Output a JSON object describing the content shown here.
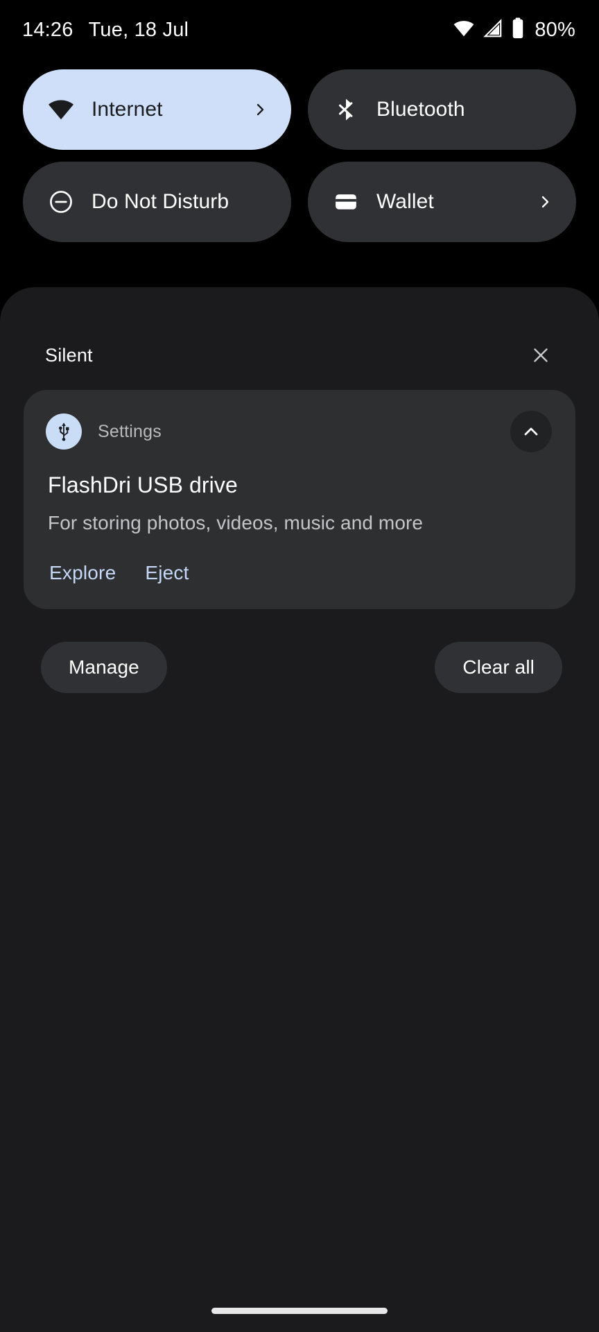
{
  "status_bar": {
    "time": "14:26",
    "date": "Tue, 18 Jul",
    "battery_percent": "80%",
    "icons": [
      "wifi-icon",
      "cellular-signal-icon",
      "battery-icon"
    ]
  },
  "quick_settings": {
    "tiles": [
      {
        "label": "Internet",
        "icon": "wifi-icon",
        "state": "active",
        "has_chevron": true
      },
      {
        "label": "Bluetooth",
        "icon": "bluetooth-icon",
        "state": "inactive",
        "has_chevron": false
      },
      {
        "label": "Do Not Disturb",
        "icon": "do-not-disturb-icon",
        "state": "inactive",
        "has_chevron": false
      },
      {
        "label": "Wallet",
        "icon": "wallet-card-icon",
        "state": "inactive",
        "has_chevron": true
      }
    ]
  },
  "notifications": {
    "section_label": "Silent",
    "close_icon": "close-icon",
    "card": {
      "app_name": "Settings",
      "app_icon": "usb-icon",
      "collapse_icon": "chevron-up-icon",
      "title": "FlashDri USB drive",
      "body": "For storing photos, videos, music and more",
      "actions": [
        "Explore",
        "Eject"
      ]
    },
    "footer": {
      "manage_label": "Manage",
      "clear_all_label": "Clear all"
    }
  },
  "nav_bar": {
    "home_indicator": "home-gesture-bar"
  },
  "colors": {
    "background": "#000000",
    "panel": "#1b1b1d",
    "tile_inactive": "#303134",
    "tile_active": "#cfdffa",
    "card": "#2e2f31",
    "accent_blue": "#c5d8f7",
    "text_primary": "#ffffff",
    "text_secondary": "#b9bbbe"
  }
}
